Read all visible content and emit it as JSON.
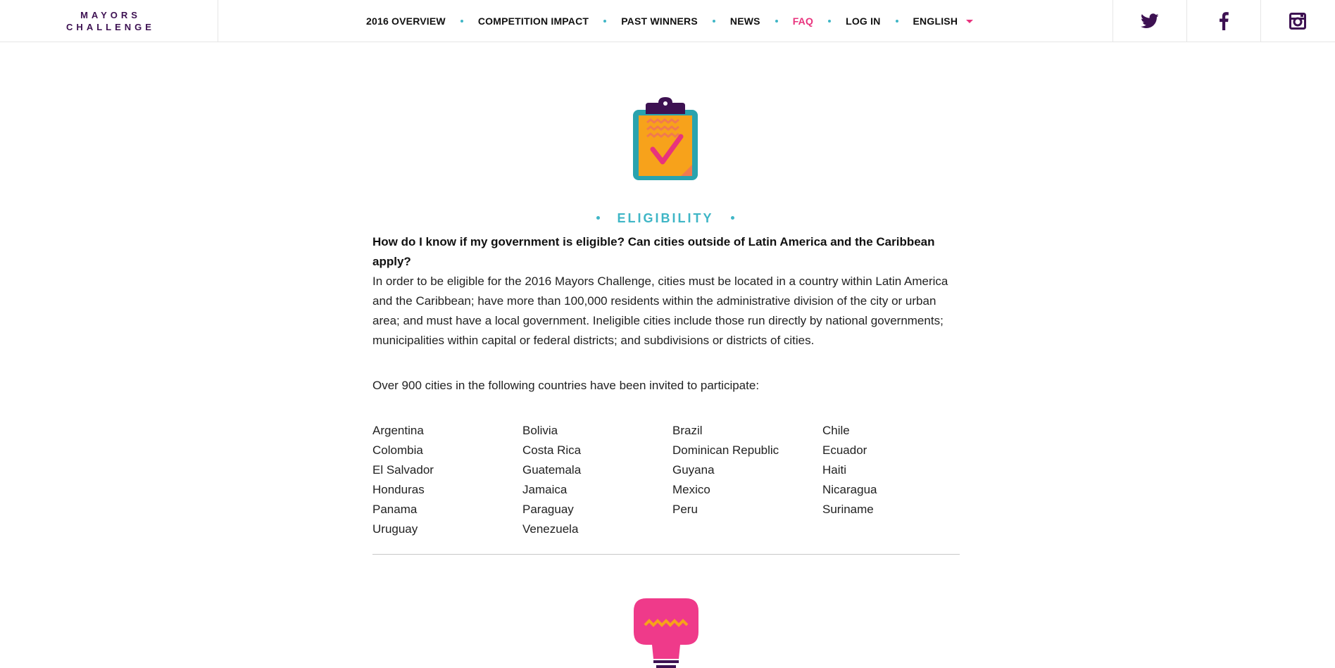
{
  "header": {
    "logo_line1": "MAYORS",
    "logo_line2": "CHALLENGE",
    "nav": [
      {
        "label": "2016 OVERVIEW"
      },
      {
        "label": "COMPETITION IMPACT"
      },
      {
        "label": "PAST WINNERS"
      },
      {
        "label": "NEWS"
      },
      {
        "label": "FAQ",
        "active": true
      },
      {
        "label": "LOG IN"
      },
      {
        "label": "ENGLISH"
      }
    ],
    "social": [
      "twitter-icon",
      "facebook-icon",
      "instagram-icon"
    ]
  },
  "section": {
    "icon": "clipboard-check-icon",
    "title": "ELIGIBILITY",
    "question": "How do I know if my government is eligible? Can cities outside of Latin America and the Caribbean apply?",
    "answer": "In order to be eligible for the 2016 Mayors Challenge, cities must be located in a country within Latin America and the Caribbean; have more than 100,000 residents within the administrative division of the city or urban area; and must have a local government. Ineligible cities include those run directly by national governments; municipalities within capital or federal districts; and subdivisions or districts of cities.",
    "intro": "Over 900 cities in the following countries have been invited to participate:",
    "countries": [
      "Argentina",
      "Bolivia",
      "Brazil",
      "Chile",
      "Colombia",
      "Costa Rica",
      "Dominican Republic",
      "Ecuador",
      "El Salvador",
      "Guatemala",
      "Guyana",
      "Haiti",
      "Honduras",
      "Jamaica",
      "Mexico",
      "Nicaragua",
      "Panama",
      "Paraguay",
      "Peru",
      "Suriname",
      "Uruguay",
      "Venezuela"
    ]
  },
  "next_section_icon": "lightbulb-icon",
  "colors": {
    "accent_teal": "#3fb6c6",
    "accent_pink": "#e8337d",
    "brand_purple": "#3d1152",
    "clipboard_orange": "#f7a21b"
  }
}
